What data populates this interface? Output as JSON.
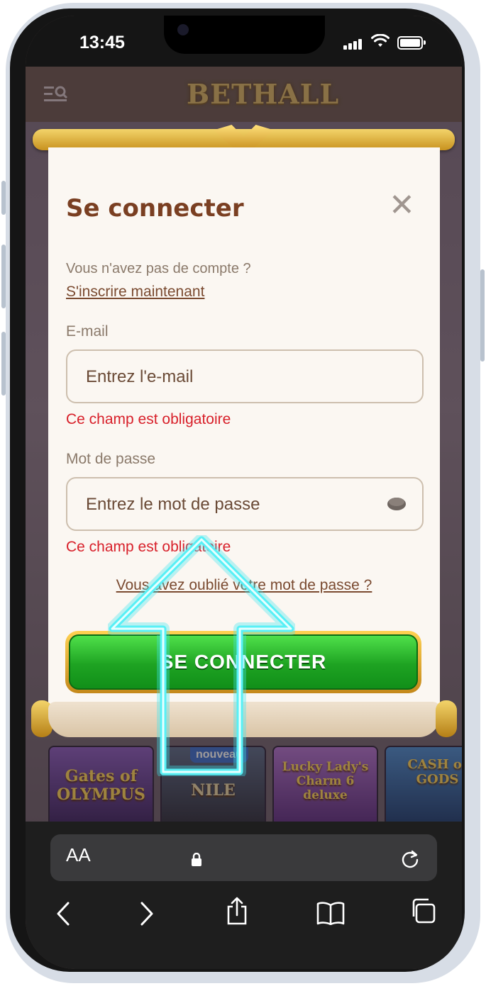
{
  "status_bar": {
    "time": "13:45"
  },
  "site": {
    "logo": "BETHALL"
  },
  "modal": {
    "title": "Se connecter",
    "close_symbol": "✕",
    "no_account_text": "Vous n'avez pas de compte ?",
    "signup_link": "S'inscrire maintenant",
    "email_label": "E-mail",
    "email_placeholder": "Entrez l'e-mail",
    "email_error": "Ce champ est obligatoire",
    "password_label": "Mot de passe",
    "password_placeholder": "Entrez le mot de passe",
    "password_error": "Ce champ est obligatoire",
    "forgot_link": "Vous avez oublié votre mot de passe ?",
    "submit_label": "SE CONNECTER"
  },
  "games": [
    {
      "title": "Gates of OLYMPUS",
      "color": "#5a3a8a"
    },
    {
      "title": "NILE",
      "badge": "nouveau",
      "color": "#3a3a5a"
    },
    {
      "title": "Lucky Lady's Charm 6 deluxe",
      "color": "#7a3aa0"
    },
    {
      "title": "CASH of GODS",
      "color": "#2a5aa0"
    }
  ],
  "browser": {
    "aa_label": "AA",
    "icons": [
      "lock-icon",
      "reload-icon",
      "back-icon",
      "forward-icon",
      "share-icon",
      "bookmarks-icon",
      "tabs-icon"
    ]
  },
  "colors": {
    "accent_green": "#1ea322",
    "error_red": "#d8202a",
    "title_brown": "#7a3f22",
    "arrow_cyan": "#3fe6f0"
  }
}
